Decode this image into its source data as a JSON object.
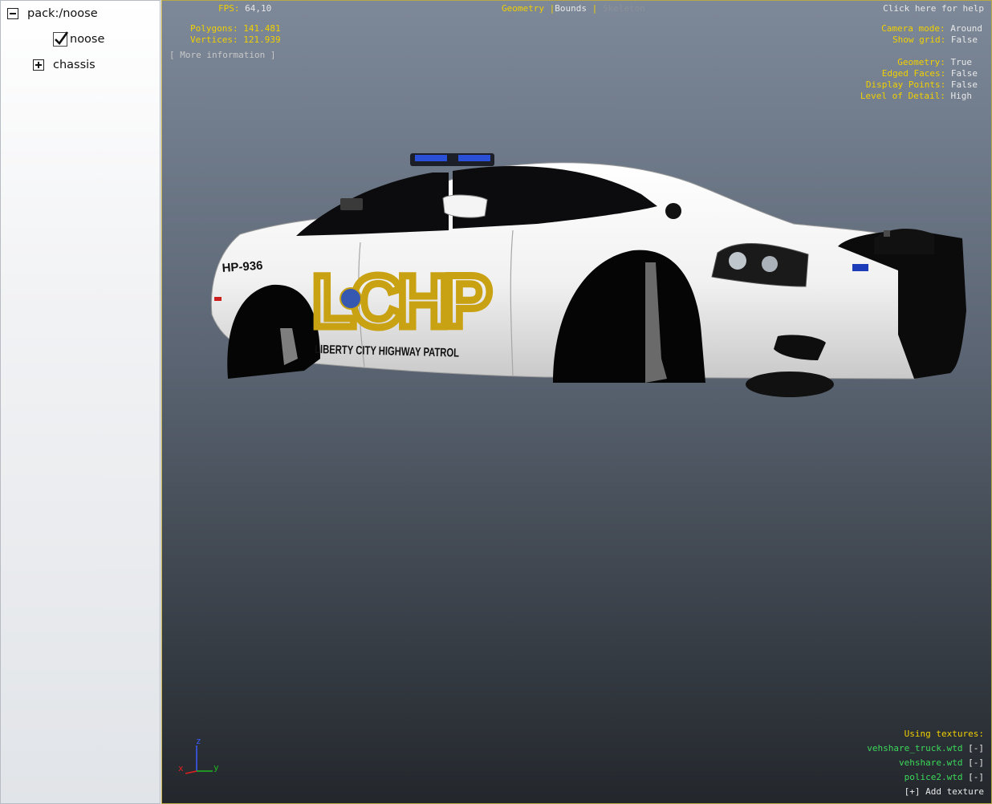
{
  "tree": {
    "root_label": "pack:/noose",
    "child_label": "noose",
    "chassis_label": "chassis"
  },
  "hud": {
    "fps_label": "FPS:",
    "fps_value": "64,10",
    "polygons_label": "Polygons:",
    "polygons_value": "141.481",
    "vertices_label": "Vertices:",
    "vertices_value": "121.939",
    "more_info": "[ More information ]",
    "tabs": {
      "geometry": "Geometry",
      "sep": "|",
      "bounds": "Bounds",
      "skeleton": "Skeleton"
    },
    "help": "Click here for help",
    "camera_mode_label": "Camera mode:",
    "camera_mode_value": "Around",
    "show_grid_label": "Show grid:",
    "show_grid_value": "False",
    "geometry_label": "Geometry:",
    "geometry_value": "True",
    "edged_faces_label": "Edged Faces:",
    "edged_faces_value": "False",
    "display_points_label": "Display Points:",
    "display_points_value": "False",
    "lod_label": "Level of Detail:",
    "lod_value": "High",
    "using_textures_label": "Using textures:",
    "textures": [
      {
        "name": "vehshare_truck.wtd",
        "action": "[-]"
      },
      {
        "name": "vehshare.wtd",
        "action": "[-]"
      },
      {
        "name": "police2.wtd",
        "action": "[-]"
      }
    ],
    "add_texture": "[+] Add texture"
  },
  "car": {
    "unit_number": "HP-936",
    "logo": "LCHP",
    "door_text": "LIBERTY CITY HIGHWAY PATROL"
  },
  "axes": {
    "z": "z",
    "x": "x",
    "y": "y"
  },
  "colors": {
    "hud_label": "#f0d000",
    "texture_name": "#3cd85a",
    "logo_gold": "#c9a213"
  }
}
